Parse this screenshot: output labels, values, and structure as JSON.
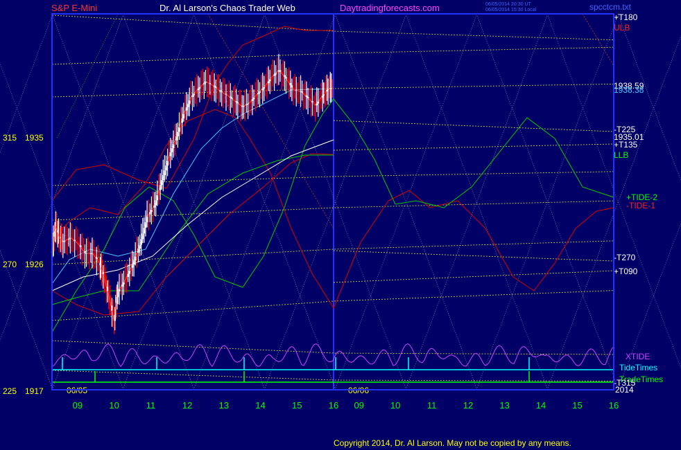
{
  "header": {
    "left_title": "S&P E-Mini",
    "center_title": "Dr. Al Larson's Chaos Trader Web",
    "site": "Daytradingforecasts.com",
    "stamp_line1": "06/05/2014 20:30 UT",
    "stamp_line2": "06/05/2014 15:30 Local",
    "symbol": "spcctcm.txt"
  },
  "copyright": "Copyright 2014, Dr. Al Larson. May not be copied by any means.",
  "colors": {
    "background": "#000066",
    "plot_border": "#2233ff",
    "price_up": "#ffffff",
    "price_down": "#ff0000",
    "grid_yellow": "#cccc44",
    "tide_green": "#00cc00",
    "tide_red": "#dd0000",
    "xtide": "#cc44ff",
    "tidetimes": "#00ffff",
    "tradetimes": "#00ff00",
    "axis_text": "#ffff00",
    "time_text": "#00ff00"
  },
  "chart_data": {
    "type": "line",
    "instrument": "S&P E-Mini",
    "y_axis_labels": [
      {
        "left": "315",
        "price": "1935",
        "value": 1935
      },
      {
        "left": "270",
        "price": "1926",
        "value": 1926
      },
      {
        "left": "225",
        "price": "1917",
        "value": 1917
      }
    ],
    "ylim": [
      1917,
      1947
    ],
    "x_ticks_day1": [
      "09",
      "10",
      "11",
      "12",
      "13",
      "14",
      "15",
      "16"
    ],
    "x_ticks_day2": [
      "09",
      "10",
      "11",
      "12",
      "13",
      "14",
      "15",
      "16"
    ],
    "dates": [
      "06/05",
      "06/06"
    ],
    "right_labels": [
      {
        "text": "+T180",
        "color": "#ffffff"
      },
      {
        "text": "ULB",
        "color": "#ff2222"
      },
      {
        "text": "1938.59",
        "color": "#ffffff"
      },
      {
        "text": "1938.38",
        "color": "#44ccff"
      },
      {
        "text": "-T225",
        "color": "#ffffff"
      },
      {
        "text": "1935.01",
        "color": "#ffffff"
      },
      {
        "text": "+T135",
        "color": "#ffffff"
      },
      {
        "text": "LLB",
        "color": "#00ff00"
      },
      {
        "text": "+TIDE-2",
        "color": "#00ff00"
      },
      {
        "text": "-TIDE-1",
        "color": "#ff2222"
      },
      {
        "text": "-T270",
        "color": "#ffffff"
      },
      {
        "text": "+T090",
        "color": "#ffffff"
      },
      {
        "text": "XTIDE",
        "color": "#cc44ff"
      },
      {
        "text": "TideTimes",
        "color": "#00ffff"
      },
      {
        "text": "TradeTimes",
        "color": "#00ff00"
      },
      {
        "text": "-T315",
        "color": "#ffffff"
      },
      {
        "text": "2014",
        "color": "#ffffff"
      }
    ],
    "price_series_day1": [
      {
        "t": 8.3,
        "c": 1926.9
      },
      {
        "t": 8.4,
        "c": 1928.7
      },
      {
        "t": 8.5,
        "c": 1928.0
      },
      {
        "t": 8.6,
        "c": 1927.6
      },
      {
        "t": 8.8,
        "c": 1927.9
      },
      {
        "t": 9.0,
        "c": 1927.5
      },
      {
        "t": 9.2,
        "c": 1926.8
      },
      {
        "t": 9.4,
        "c": 1926.8
      },
      {
        "t": 9.6,
        "c": 1926.1
      },
      {
        "t": 9.7,
        "c": 1925.3
      },
      {
        "t": 9.85,
        "c": 1923.8
      },
      {
        "t": 10.0,
        "c": 1922.0
      },
      {
        "t": 10.1,
        "c": 1924.1
      },
      {
        "t": 10.3,
        "c": 1924.9
      },
      {
        "t": 10.5,
        "c": 1926.0
      },
      {
        "t": 10.7,
        "c": 1927.4
      },
      {
        "t": 10.9,
        "c": 1929.4
      },
      {
        "t": 11.1,
        "c": 1930.2
      },
      {
        "t": 11.3,
        "c": 1932.0
      },
      {
        "t": 11.5,
        "c": 1933.7
      },
      {
        "t": 11.7,
        "c": 1935.1
      },
      {
        "t": 11.9,
        "c": 1936.7
      },
      {
        "t": 12.1,
        "c": 1937.9
      },
      {
        "t": 12.3,
        "c": 1938.5
      },
      {
        "t": 12.5,
        "c": 1939.0
      },
      {
        "t": 12.7,
        "c": 1938.7
      },
      {
        "t": 12.9,
        "c": 1938.3
      },
      {
        "t": 13.1,
        "c": 1938.0
      },
      {
        "t": 13.3,
        "c": 1937.6
      },
      {
        "t": 13.5,
        "c": 1937.2
      },
      {
        "t": 13.7,
        "c": 1937.5
      },
      {
        "t": 13.9,
        "c": 1938.1
      },
      {
        "t": 14.1,
        "c": 1938.6
      },
      {
        "t": 14.3,
        "c": 1939.3
      },
      {
        "t": 14.5,
        "c": 1939.8
      },
      {
        "t": 14.7,
        "c": 1939.2
      },
      {
        "t": 14.9,
        "c": 1938.4
      },
      {
        "t": 15.1,
        "c": 1938.3
      },
      {
        "t": 15.3,
        "c": 1937.8
      },
      {
        "t": 15.5,
        "c": 1937.3
      },
      {
        "t": 15.7,
        "c": 1938.0
      },
      {
        "t": 15.85,
        "c": 1938.5
      },
      {
        "t": 16.0,
        "c": 1938.6
      }
    ]
  }
}
